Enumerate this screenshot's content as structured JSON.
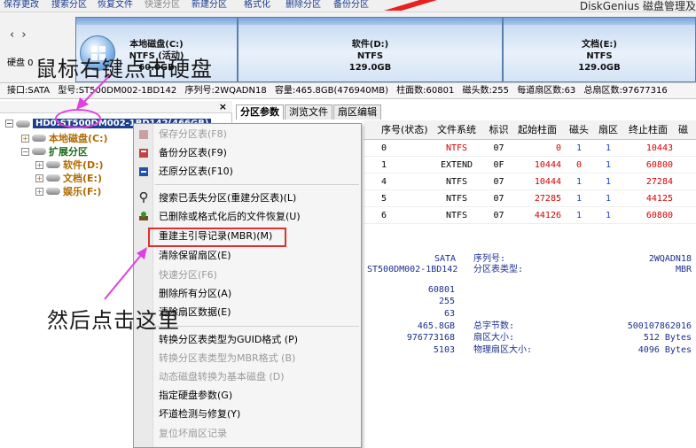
{
  "toolbar": {
    "items": [
      "保存更改",
      "搜索分区",
      "恢复文件",
      "快速分区",
      "新建分区",
      "格式化",
      "删除分区",
      "备份分区"
    ],
    "brand": "DiskGenius 磁盘管理及"
  },
  "disk_label": "硬盘 0",
  "partitions": [
    {
      "name": "本地磁盘(C:)",
      "fs": "NTFS (活动)",
      "size": "60.0GB"
    },
    {
      "name": "软件(D:)",
      "fs": "NTFS",
      "size": "129.0GB"
    },
    {
      "name": "文档(E:)",
      "fs": "NTFS",
      "size": "129.0GB"
    }
  ],
  "info_line": {
    "iface": "接口:SATA",
    "model": "型号:ST500DM002-1BD142",
    "serial": "序列号:2WQADN18",
    "capacity": "容量:465.8GB(476940MB)",
    "cylinders": "柱面数:60801",
    "heads": "磁头数:255",
    "sectors": "每道扇区数:63",
    "total": "总扇区数:97677316"
  },
  "tree": {
    "hdd": "HD0:ST500DM002-1BD142(466GB)",
    "c": "本地磁盘(C:)",
    "ext": "扩展分区",
    "d": "软件(D:)",
    "e": "文档(E:)",
    "f": "娱乐(F:)"
  },
  "annotations": {
    "step1": "鼠标右键点击硬盘",
    "step2": "然后点击这里"
  },
  "tabs": [
    "分区参数",
    "浏览文件",
    "扇区编辑"
  ],
  "table": {
    "headers": [
      "序号(状态)",
      "文件系统",
      "标识",
      "起始柱面",
      "磁头",
      "扇区",
      "终止柱面",
      "磁"
    ],
    "rows": [
      [
        "0",
        "NTFS",
        "07",
        "0",
        "1",
        "1",
        "10443"
      ],
      [
        "1",
        "EXTEND",
        "0F",
        "10444",
        "0",
        "1",
        "60800"
      ],
      [
        "4",
        "NTFS",
        "07",
        "10444",
        "1",
        "1",
        "27284"
      ],
      [
        "5",
        "NTFS",
        "07",
        "27285",
        "1",
        "1",
        "44125"
      ],
      [
        "6",
        "NTFS",
        "07",
        "44126",
        "1",
        "1",
        "60800"
      ]
    ]
  },
  "details": {
    "iface": "SATA",
    "model": "ST500DM002-1BD142",
    "serial_label": "序列号:",
    "ptype_label": "分区表类型:",
    "serial": "2WQADN18",
    "ptype": "MBR",
    "cyl": "60801",
    "heads": "255",
    "sectors": "63",
    "capacity": "465.8GB",
    "total_sectors": "976773168",
    "extra": "5103",
    "bytes_label": "总字节数:",
    "sector_label": "扇区大小:",
    "phys_label": "物理扇区大小:",
    "bytes": "500107862016",
    "sector_size": "512 Bytes",
    "phys_size": "4096 Bytes"
  },
  "menu": {
    "items": [
      {
        "label": "保存分区表(F8)",
        "disabled": true
      },
      {
        "label": "备份分区表(F9)",
        "disabled": false
      },
      {
        "label": "还原分区表(F10)",
        "disabled": false
      },
      {
        "label": "搜索已丢失分区(重建分区表)(L)",
        "disabled": false
      },
      {
        "label": "已删除或格式化后的文件恢复(U)",
        "disabled": false
      },
      {
        "label": "重建主引导记录(MBR)(M)",
        "disabled": false
      },
      {
        "label": "清除保留扇区(E)",
        "disabled": false
      },
      {
        "label": "快速分区(F6)",
        "disabled": true
      },
      {
        "label": "删除所有分区(A)",
        "disabled": false
      },
      {
        "label": "清除扇区数据(E)",
        "disabled": false
      },
      {
        "label": "转换分区表类型为GUID格式 (P)",
        "disabled": false
      },
      {
        "label": "转换分区表类型为MBR格式 (B)",
        "disabled": true
      },
      {
        "label": "动态磁盘转换为基本磁盘 (D)",
        "disabled": true
      },
      {
        "label": "指定硬盘参数(G)",
        "disabled": false
      },
      {
        "label": "坏道检测与修复(Y)",
        "disabled": false
      },
      {
        "label": "复位坏扇区记录",
        "disabled": true
      }
    ]
  },
  "colors": {
    "highlight": "#e03030",
    "annotation_arrow": "#e040e0",
    "accent": "#1f3f8f"
  }
}
